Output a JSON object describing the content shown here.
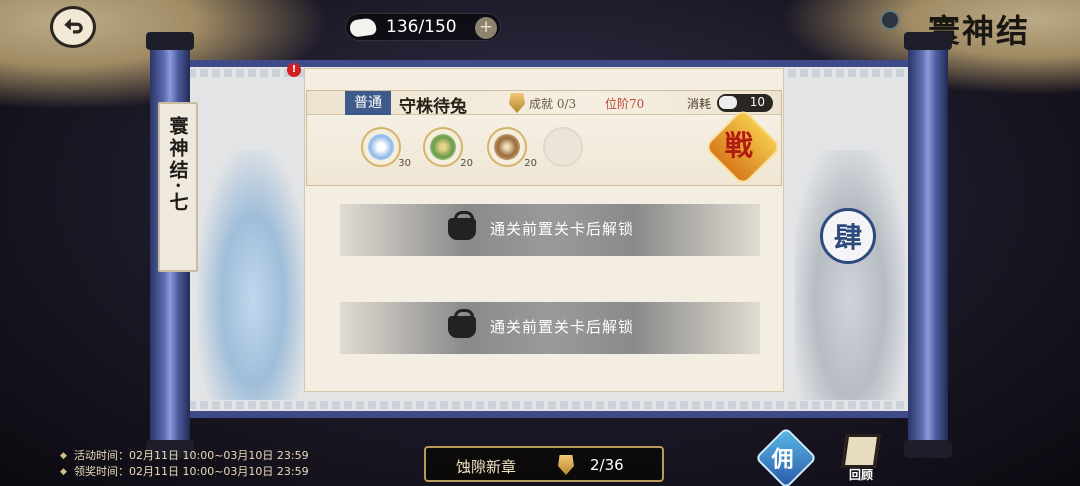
{
  "header": {
    "event_title": "寰神结",
    "resource": {
      "text": "136/150",
      "plus": "+"
    }
  },
  "chapter": {
    "banner": "寰神结·七",
    "next_seal": "肆"
  },
  "stage": {
    "difficulty": "普通",
    "name": "守株待兔",
    "achievement": "成就 0/3",
    "rank": "位阶70",
    "cost_label": "消耗",
    "cost_value": "10",
    "rewards": [
      {
        "icon": "crystal-star-icon",
        "count": "30"
      },
      {
        "icon": "green-ornament-icon",
        "count": "20"
      },
      {
        "icon": "bronze-shield-icon",
        "count": "20"
      },
      {
        "icon": "empty-slot-icon",
        "count": ""
      }
    ],
    "fight_label": "戦"
  },
  "locked_rows": [
    {
      "text": "通关前置关卡后解锁"
    },
    {
      "text": "通关前置关卡后解锁"
    }
  ],
  "alert": "!",
  "footer": {
    "activity_time": "活动时间：02月11日 10:00~03月10日 23:59",
    "reward_time": "领奖时间：02月11日 10:00~03月10日 23:59",
    "progress_label": "蚀隙新章",
    "progress_value": "2/36",
    "mirror_label": "佣",
    "review_label": "回顾"
  }
}
